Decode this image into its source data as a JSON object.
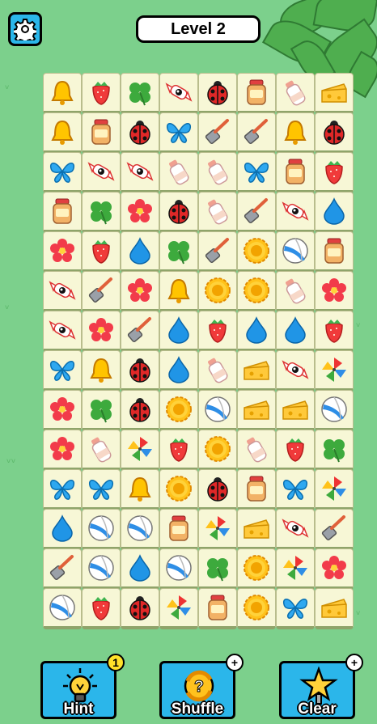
{
  "header": {
    "level_label": "Level 2"
  },
  "board": {
    "rows": [
      [
        "bell",
        "strawberry",
        "clover",
        "candy",
        "ladybug",
        "jar",
        "bottle",
        "cheese"
      ],
      [
        "bell",
        "jar",
        "ladybug",
        "butterfly",
        "spatula",
        "spatula",
        "bell",
        "ladybug"
      ],
      [
        "butterfly",
        "candy",
        "candy",
        "bottle",
        "bottle",
        "butterfly",
        "jar",
        "strawberry"
      ],
      [
        "jar",
        "clover",
        "flower",
        "ladybug",
        "bottle",
        "spatula",
        "candy",
        "drop"
      ],
      [
        "flower",
        "strawberry",
        "drop",
        "clover",
        "spatula",
        "sunflower",
        "ball",
        "jar"
      ],
      [
        "candy",
        "spatula",
        "flower",
        "bell",
        "sunflower",
        "sunflower",
        "bottle",
        "flower"
      ],
      [
        "candy",
        "flower",
        "spatula",
        "drop",
        "strawberry",
        "drop",
        "drop",
        "strawberry"
      ],
      [
        "butterfly",
        "bell",
        "ladybug",
        "drop",
        "bottle",
        "cheese",
        "candy",
        "pinwheel"
      ],
      [
        "flower",
        "clover",
        "ladybug",
        "sunflower",
        "ball",
        "cheese",
        "cheese",
        "ball"
      ],
      [
        "flower",
        "bottle",
        "pinwheel",
        "strawberry",
        "sunflower",
        "bottle",
        "strawberry",
        "clover"
      ],
      [
        "butterfly",
        "butterfly",
        "bell",
        "sunflower",
        "ladybug",
        "jar",
        "butterfly",
        "pinwheel"
      ],
      [
        "drop",
        "ball",
        "ball",
        "jar",
        "pinwheel",
        "cheese",
        "candy",
        "spatula"
      ],
      [
        "spatula",
        "ball",
        "drop",
        "ball",
        "clover",
        "sunflower",
        "pinwheel",
        "flower"
      ],
      [
        "ball",
        "strawberry",
        "ladybug",
        "pinwheel",
        "jar",
        "sunflower",
        "butterfly",
        "cheese"
      ]
    ]
  },
  "buttons": {
    "hint": {
      "label": "Hint",
      "badge": "1",
      "icon": "lightbulb-icon"
    },
    "shuffle": {
      "label": "Shuffle",
      "badge": "+",
      "icon": "shuffle-icon"
    },
    "clear": {
      "label": "Clear",
      "badge": "+",
      "icon": "star-clear-icon"
    }
  },
  "colors": {
    "background": "#7cd08c",
    "button": "#2bb6ea",
    "tile": "#f7f7d6",
    "hint_badge": "#ffe12a"
  }
}
